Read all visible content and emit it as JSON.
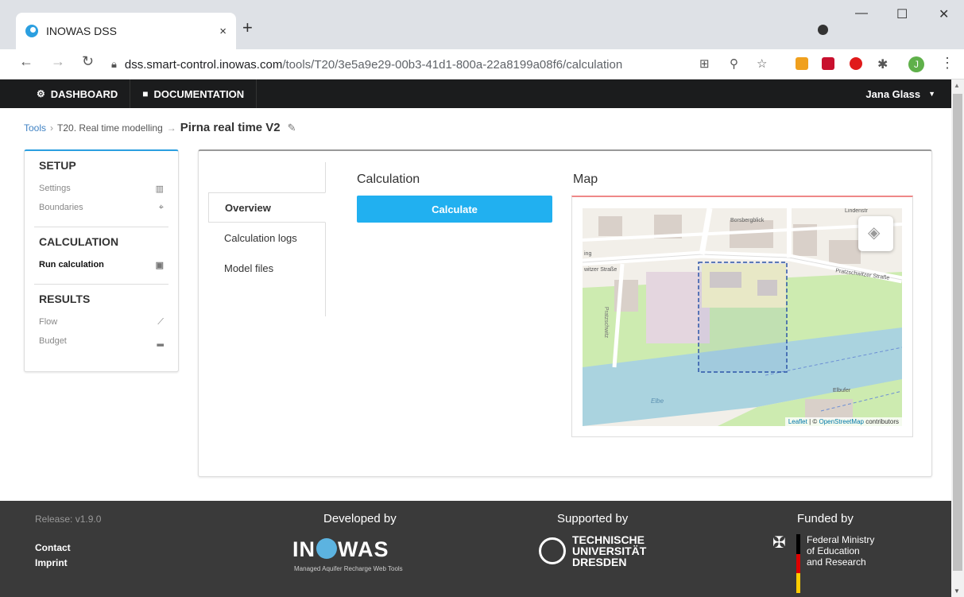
{
  "browser": {
    "tab_title": "INOWAS DSS",
    "tab_close": "×",
    "new_tab": "+",
    "url_host": "dss.smart-control.inowas.com",
    "url_path": "/tools/T20/3e5a9e29-00b3-41d1-800a-22a8199a08f6/calculation",
    "avatar_letter": "J",
    "minimize": "—",
    "maximize": "☐",
    "close": "✕"
  },
  "navbar": {
    "dashboard": "DASHBOARD",
    "documentation": "DOCUMENTATION",
    "user": "Jana Glass"
  },
  "breadcrumb": {
    "tools": "Tools",
    "tool": "T20. Real time modelling",
    "current": "Pirna real time V2"
  },
  "sidebar": {
    "setup_title": "SETUP",
    "settings": "Settings",
    "boundaries": "Boundaries",
    "calculation_title": "CALCULATION",
    "run_calculation": "Run calculation",
    "results_title": "RESULTS",
    "flow": "Flow",
    "budget": "Budget"
  },
  "tabs": {
    "overview": "Overview",
    "calculation_logs": "Calculation logs",
    "model_files": "Model files"
  },
  "calculation": {
    "heading": "Calculation",
    "button": "Calculate"
  },
  "map": {
    "heading": "Map",
    "attribution_leaflet": "Leaflet",
    "attribution_sep": " | © ",
    "attribution_osm": "OpenStreetMap",
    "attribution_tail": " contributors",
    "labels": {
      "borsbergblick": "Borsbergblick",
      "pratzschwitzer_strasse": "Pratzschwitzer Straße",
      "witzer_strasse": "witzer Straße",
      "elbe": "Elbe",
      "lindenstr": "Lindenstr",
      "elbufer": "Elbufer",
      "pratzschwitz": "Pratzschwitz",
      "ing": "ing"
    }
  },
  "footer": {
    "release": "Release: v1.9.0",
    "contact": "Contact",
    "imprint": "Imprint",
    "developed_by": "Developed by",
    "supported_by": "Supported by",
    "funded_by": "Funded by",
    "inowas_left": "IN",
    "inowas_right": "WAS",
    "inowas_sub": "Managed Aquifer Recharge Web Tools",
    "tud_line1": "TECHNISCHE",
    "tud_line2": "UNIVERSITÄT",
    "tud_line3": "DRESDEN",
    "bmbf_line1": "Federal Ministry",
    "bmbf_line2": "of Education",
    "bmbf_line3": "and Research"
  }
}
